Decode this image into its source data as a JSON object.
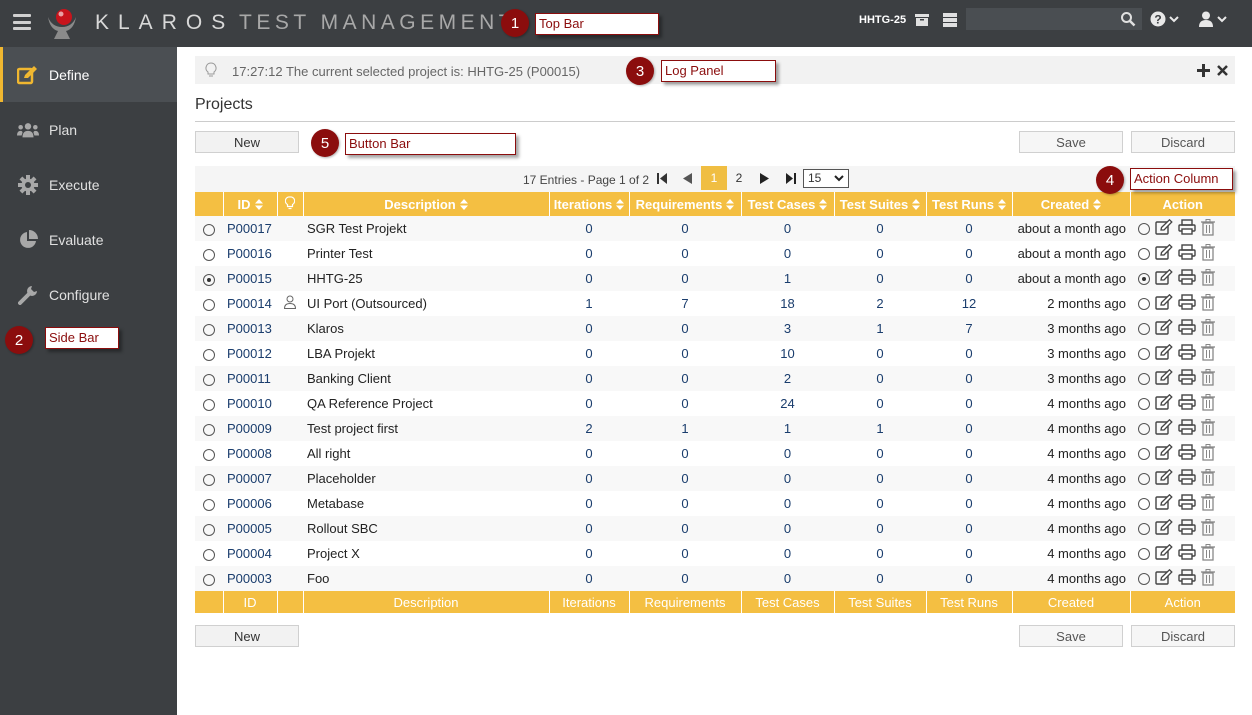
{
  "topbar": {
    "brand_primary": "KLAROS",
    "brand_secondary": "TEST MANAGEMENT",
    "project_label": "HHTG-25",
    "search_placeholder": "",
    "icons": [
      "menu-icon",
      "archive-icon",
      "server-icon",
      "search-icon",
      "help-icon",
      "user-icon"
    ]
  },
  "sidebar": {
    "items": [
      {
        "label": "Define",
        "icon": "edit-icon",
        "active": true
      },
      {
        "label": "Plan",
        "icon": "users-icon",
        "active": false
      },
      {
        "label": "Execute",
        "icon": "gear-icon",
        "active": false
      },
      {
        "label": "Evaluate",
        "icon": "pie-chart-icon",
        "active": false
      },
      {
        "label": "Configure",
        "icon": "wrench-icon",
        "active": false
      }
    ]
  },
  "log_panel": {
    "message": "17:27:12 The current selected project is: HHTG-25 (P00015)"
  },
  "page": {
    "title": "Projects"
  },
  "buttons": {
    "new": "New",
    "save": "Save",
    "discard": "Discard"
  },
  "pager": {
    "summary": "17 Entries - Page 1 of 2",
    "pages": [
      "1",
      "2"
    ],
    "current_page": "1",
    "page_size": "15"
  },
  "table": {
    "headers": [
      "",
      "ID",
      "",
      "Description",
      "Iterations",
      "Requirements",
      "Test Cases",
      "Test Suites",
      "Test Runs",
      "Created",
      "Action"
    ],
    "footer": [
      "",
      "ID",
      "",
      "Description",
      "Iterations",
      "Requirements",
      "Test Cases",
      "Test Suites",
      "Test Runs",
      "Created",
      "Action"
    ],
    "rows": [
      {
        "id": "P00017",
        "user": false,
        "desc": "SGR Test Projekt",
        "iter": "0",
        "req": "0",
        "tc": "0",
        "ts": "0",
        "tr": "0",
        "created": "about a month ago",
        "selected": false
      },
      {
        "id": "P00016",
        "user": false,
        "desc": "Printer Test",
        "iter": "0",
        "req": "0",
        "tc": "0",
        "ts": "0",
        "tr": "0",
        "created": "about a month ago",
        "selected": false
      },
      {
        "id": "P00015",
        "user": false,
        "desc": "HHTG-25",
        "iter": "0",
        "req": "0",
        "tc": "1",
        "ts": "0",
        "tr": "0",
        "created": "about a month ago",
        "selected": true
      },
      {
        "id": "P00014",
        "user": true,
        "desc": "UI Port (Outsourced)",
        "iter": "1",
        "req": "7",
        "tc": "18",
        "ts": "2",
        "tr": "12",
        "created": "2 months ago",
        "selected": false
      },
      {
        "id": "P00013",
        "user": false,
        "desc": "Klaros",
        "iter": "0",
        "req": "0",
        "tc": "3",
        "ts": "1",
        "tr": "7",
        "created": "3 months ago",
        "selected": false
      },
      {
        "id": "P00012",
        "user": false,
        "desc": "LBA Projekt",
        "iter": "0",
        "req": "0",
        "tc": "10",
        "ts": "0",
        "tr": "0",
        "created": "3 months ago",
        "selected": false
      },
      {
        "id": "P00011",
        "user": false,
        "desc": "Banking Client",
        "iter": "0",
        "req": "0",
        "tc": "2",
        "ts": "0",
        "tr": "0",
        "created": "3 months ago",
        "selected": false
      },
      {
        "id": "P00010",
        "user": false,
        "desc": "QA Reference Project",
        "iter": "0",
        "req": "0",
        "tc": "24",
        "ts": "0",
        "tr": "0",
        "created": "4 months ago",
        "selected": false
      },
      {
        "id": "P00009",
        "user": false,
        "desc": "Test project first",
        "iter": "2",
        "req": "1",
        "tc": "1",
        "ts": "1",
        "tr": "0",
        "created": "4 months ago",
        "selected": false
      },
      {
        "id": "P00008",
        "user": false,
        "desc": "All right",
        "iter": "0",
        "req": "0",
        "tc": "0",
        "ts": "0",
        "tr": "0",
        "created": "4 months ago",
        "selected": false
      },
      {
        "id": "P00007",
        "user": false,
        "desc": "Placeholder",
        "iter": "0",
        "req": "0",
        "tc": "0",
        "ts": "0",
        "tr": "0",
        "created": "4 months ago",
        "selected": false
      },
      {
        "id": "P00006",
        "user": false,
        "desc": "Metabase",
        "iter": "0",
        "req": "0",
        "tc": "0",
        "ts": "0",
        "tr": "0",
        "created": "4 months ago",
        "selected": false
      },
      {
        "id": "P00005",
        "user": false,
        "desc": "Rollout SBC",
        "iter": "0",
        "req": "0",
        "tc": "0",
        "ts": "0",
        "tr": "0",
        "created": "4 months ago",
        "selected": false
      },
      {
        "id": "P00004",
        "user": false,
        "desc": "Project X",
        "iter": "0",
        "req": "0",
        "tc": "0",
        "ts": "0",
        "tr": "0",
        "created": "4 months ago",
        "selected": false
      },
      {
        "id": "P00003",
        "user": false,
        "desc": "Foo",
        "iter": "0",
        "req": "0",
        "tc": "0",
        "ts": "0",
        "tr": "0",
        "created": "4 months ago",
        "selected": false
      }
    ]
  },
  "annotations": [
    {
      "number": "1",
      "label": "Top Bar"
    },
    {
      "number": "2",
      "label": "Side Bar"
    },
    {
      "number": "3",
      "label": "Log Panel"
    },
    {
      "number": "4",
      "label": "Action Column"
    },
    {
      "number": "5",
      "label": "Button Bar"
    }
  ],
  "colors": {
    "topbar_bg": "#3c3f42",
    "accent": "#f4bf42",
    "link": "#1a3d6d",
    "annotation": "#8b0d0d"
  }
}
